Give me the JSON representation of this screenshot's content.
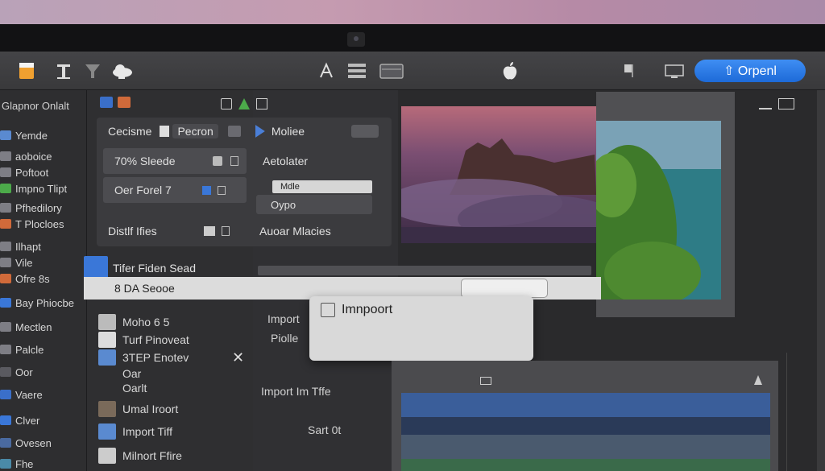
{
  "window": {
    "open_button_label": "⇧ Orpenl",
    "apple_glyph": ""
  },
  "toolbar": {
    "icons": [
      "document-icon",
      "text-icon",
      "filter-icon",
      "cloud-icon",
      "pen-icon",
      "list-icon",
      "tray-icon",
      "apple-logo",
      "flag-icon",
      "monitor-icon"
    ]
  },
  "sidebar": {
    "title": "Glapnor Onlalt",
    "items": [
      {
        "label": "Yemde",
        "icon": "folder-icon"
      },
      {
        "label": "aoboice",
        "icon": "folder-icon"
      },
      {
        "label": "Poftoot",
        "icon": "folder-icon"
      },
      {
        "label": "Impno Tlipt",
        "icon": "folder-icon"
      },
      {
        "label": "Pfhedilory",
        "icon": "folder-icon"
      },
      {
        "label": "T Plocloes",
        "icon": "folder-icon"
      },
      {
        "label": "Ilhapt",
        "icon": "folder-icon"
      },
      {
        "label": "Vile",
        "icon": "folder-icon"
      },
      {
        "label": "Ofre 8s",
        "icon": "folder-icon"
      },
      {
        "label": "Bay Phiocbe",
        "icon": "folder-icon"
      },
      {
        "label": "Mectlen",
        "icon": "folder-icon"
      },
      {
        "label": "Palcle",
        "icon": "folder-icon"
      },
      {
        "label": "Oor",
        "icon": "folder-icon"
      },
      {
        "label": "Vaere",
        "icon": "folder-icon"
      },
      {
        "label": "Clver",
        "icon": "folder-icon"
      },
      {
        "label": "Ovesen",
        "icon": "folder-icon"
      },
      {
        "label": "Fhe",
        "icon": "folder-icon"
      }
    ]
  },
  "panel": {
    "header_left": "Cecisme",
    "header_field": "Pecron",
    "header_right": "Moliee",
    "row1_left": "70% Sleede",
    "row1_right": "Aetolater",
    "row1_field": "Mdle",
    "row2_left": "Oer Forel 7",
    "row2_right": "Oypo",
    "row3_left": "Distlf Ifies",
    "row3_right": "Auoar Mlacies"
  },
  "strip": {
    "label_top": "Tifer Fiden Sead",
    "label": "8 DA Seooe"
  },
  "dialog": {
    "title": "Imnpoort"
  },
  "lower": {
    "items": [
      {
        "label": "Moho 6 5"
      },
      {
        "label": "Turf Pinoveat"
      },
      {
        "label": "3TEP Enotev"
      },
      {
        "label": "Oar"
      },
      {
        "label": "Oarlt"
      },
      {
        "label": "Umal Iroort"
      },
      {
        "label": "Import Tiff"
      },
      {
        "label": "Milnort Ffire"
      }
    ],
    "mid_col": [
      "Import",
      "Piolle",
      "Import Im Tffe",
      "Sart 0t"
    ]
  }
}
